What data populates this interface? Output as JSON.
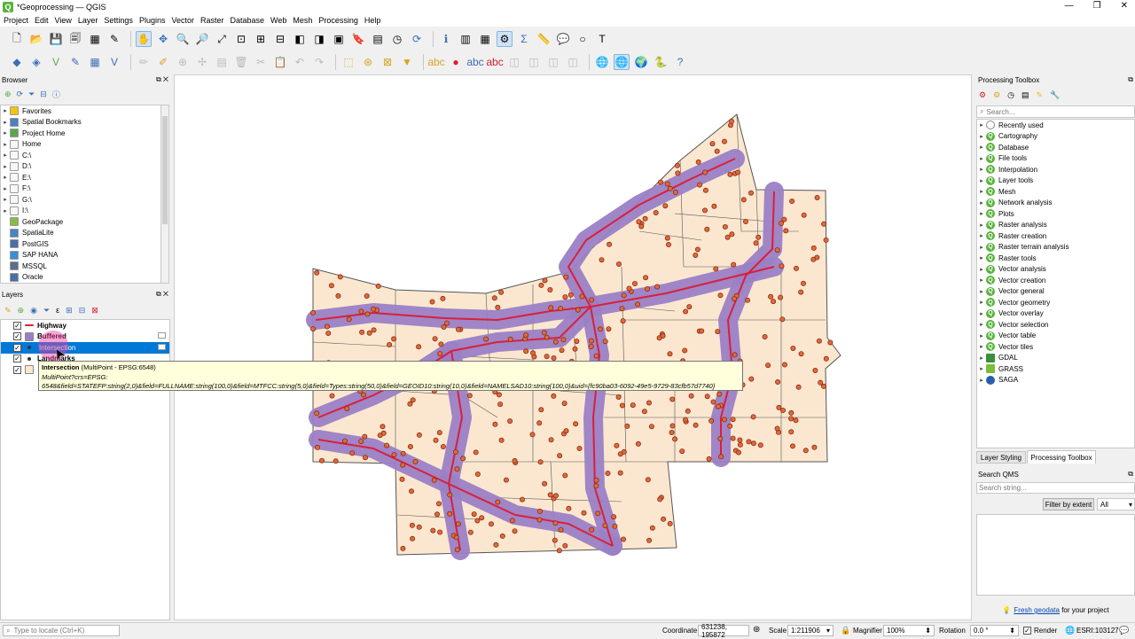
{
  "window": {
    "title": "*Geoprocessing — QGIS",
    "app_icon": "qgis-icon",
    "controls": [
      "—",
      "❐",
      "✕"
    ]
  },
  "menu": [
    "Project",
    "Edit",
    "View",
    "Layer",
    "Settings",
    "Plugins",
    "Vector",
    "Raster",
    "Database",
    "Web",
    "Mesh",
    "Processing",
    "Help"
  ],
  "browser": {
    "title": "Browser",
    "items": [
      {
        "label": "Favorites",
        "icon": "star-icon",
        "color": "#f2c40f"
      },
      {
        "label": "Spatial Bookmarks",
        "icon": "bookmark-icon",
        "color": "#4f7fbf"
      },
      {
        "label": "Project Home",
        "icon": "home-folder-icon",
        "color": "#5aa64b"
      },
      {
        "label": "Home",
        "icon": "folder-icon",
        "color": "#f7f7f7"
      },
      {
        "label": "C:\\",
        "icon": "drive-icon",
        "color": "#f7f7f7"
      },
      {
        "label": "D:\\",
        "icon": "drive-icon",
        "color": "#f7f7f7"
      },
      {
        "label": "E:\\",
        "icon": "drive-icon",
        "color": "#f7f7f7"
      },
      {
        "label": "F:\\",
        "icon": "drive-icon",
        "color": "#f7f7f7"
      },
      {
        "label": "G:\\",
        "icon": "drive-icon",
        "color": "#f7f7f7"
      },
      {
        "label": "I:\\",
        "icon": "drive-icon",
        "color": "#f7f7f7"
      },
      {
        "label": "GeoPackage",
        "icon": "geopackage-icon",
        "color": "#8bb94a"
      },
      {
        "label": "SpatiaLite",
        "icon": "spatialite-icon",
        "color": "#4a84c4"
      },
      {
        "label": "PostGIS",
        "icon": "postgis-icon",
        "color": "#4a6fa5"
      },
      {
        "label": "SAP HANA",
        "icon": "sap-hana-icon",
        "color": "#3b8fd6"
      },
      {
        "label": "MSSQL",
        "icon": "mssql-icon",
        "color": "#5b6f8a"
      },
      {
        "label": "Oracle",
        "icon": "oracle-icon",
        "color": "#4a6fa5"
      }
    ]
  },
  "layers": {
    "title": "Layers",
    "items": [
      {
        "label": "Highway",
        "checked": true,
        "icon": "line-layer-icon",
        "bold": true
      },
      {
        "label": "Buffered",
        "checked": true,
        "icon": "polygon-layer-icon",
        "bold": true
      },
      {
        "label": "Intersection",
        "checked": true,
        "icon": "point-layer-icon",
        "bold": false,
        "selected": true
      },
      {
        "label": "Landmarks",
        "checked": true,
        "icon": "point-layer-icon",
        "bold": true
      },
      {
        "label": "",
        "checked": true,
        "icon": "polygon-layer-icon",
        "bold": false
      }
    ],
    "tooltip": {
      "name": "Intersection",
      "crs": "(MultiPoint - EPSG:6548)",
      "line2": "MultiPoint?crs=EPSG:",
      "line3": "6548&field=STATEFP:string(2,0)&field=FULLNAME:string(100,0)&field=MTFCC:string(5,0)&field=Types:string(50,0)&field=GEOID10:string(10,0)&field=NAMELSAD10:string(100,0)&uid={fc90ba03-6092-49e5-9729-83cfb57d7740}"
    }
  },
  "toolbox": {
    "title": "Processing Toolbox",
    "search_placeholder": "Search...",
    "items": [
      {
        "label": "Recently used",
        "icon": "clock-icon"
      },
      {
        "label": "Cartography",
        "icon": "qgis-icon"
      },
      {
        "label": "Database",
        "icon": "qgis-icon"
      },
      {
        "label": "File tools",
        "icon": "qgis-icon"
      },
      {
        "label": "Interpolation",
        "icon": "qgis-icon"
      },
      {
        "label": "Layer tools",
        "icon": "qgis-icon"
      },
      {
        "label": "Mesh",
        "icon": "qgis-icon"
      },
      {
        "label": "Network analysis",
        "icon": "qgis-icon"
      },
      {
        "label": "Plots",
        "icon": "qgis-icon"
      },
      {
        "label": "Raster analysis",
        "icon": "qgis-icon"
      },
      {
        "label": "Raster creation",
        "icon": "qgis-icon"
      },
      {
        "label": "Raster terrain analysis",
        "icon": "qgis-icon"
      },
      {
        "label": "Raster tools",
        "icon": "qgis-icon"
      },
      {
        "label": "Vector analysis",
        "icon": "qgis-icon"
      },
      {
        "label": "Vector creation",
        "icon": "qgis-icon"
      },
      {
        "label": "Vector general",
        "icon": "qgis-icon"
      },
      {
        "label": "Vector geometry",
        "icon": "qgis-icon"
      },
      {
        "label": "Vector overlay",
        "icon": "qgis-icon"
      },
      {
        "label": "Vector selection",
        "icon": "qgis-icon"
      },
      {
        "label": "Vector table",
        "icon": "qgis-icon"
      },
      {
        "label": "Vector tiles",
        "icon": "qgis-icon"
      },
      {
        "label": "GDAL",
        "icon": "gdal-icon"
      },
      {
        "label": "GRASS",
        "icon": "grass-icon"
      },
      {
        "label": "SAGA",
        "icon": "saga-icon"
      }
    ],
    "tabs": [
      "Layer Styling",
      "Processing Toolbox"
    ]
  },
  "qms": {
    "title": "Search QMS",
    "search_placeholder": "Search string...",
    "filter_button": "Filter by extent",
    "filter_select": "All",
    "footer_link": "Fresh geodata",
    "footer_text": " for your project"
  },
  "status": {
    "locate_placeholder": "Type to locate (Ctrl+K)",
    "coordinate_label": "Coordinate",
    "coordinate_value": "631238, 195872",
    "scale_label": "Scale",
    "scale_value": "1:211906",
    "magnifier_label": "Magnifier",
    "magnifier_value": "100%",
    "rotation_label": "Rotation",
    "rotation_value": "0.0 °",
    "render_label": "Render",
    "crs_value": "ESRI:103127"
  },
  "colors": {
    "county_fill": "#fbe7d0",
    "county_stroke": "#555555",
    "buffer": "#9b7fc6",
    "highway": "#d8203a",
    "point_fill": "#e06a3a",
    "point_stroke": "#8a2b14",
    "selection": "#0078d7"
  }
}
